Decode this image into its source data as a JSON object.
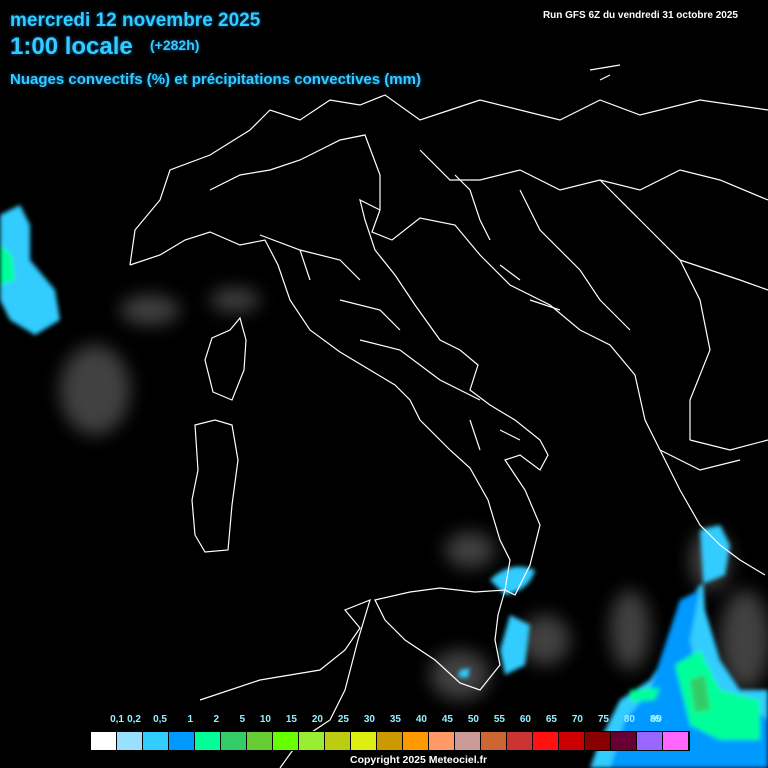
{
  "header": {
    "date": "mercredi 12 novembre 2025",
    "time": "1:00 locale",
    "lead": "(+282h)",
    "parameter": "Nuages convectifs (%) et précipitations convectives (mm)",
    "run": "Run GFS 6Z du vendredi 31 octobre 2025"
  },
  "legend": {
    "labels": [
      "0,1",
      "0,2",
      "0,5",
      "1",
      "2",
      "5",
      "10",
      "15",
      "20",
      "25",
      "30",
      "35",
      "40",
      "45",
      "50",
      "55",
      "60",
      "65",
      "70",
      "75",
      "80",
      "85",
      "90"
    ],
    "colors": [
      "#ffffff",
      "#99e0ff",
      "#33ccff",
      "#0099ff",
      "#00ff99",
      "#33cc66",
      "#66cc33",
      "#66ff00",
      "#99ee33",
      "#bbcc11",
      "#ddee11",
      "#cc9900",
      "#ff9900",
      "#ff9966",
      "#cc9999",
      "#cc6633",
      "#cc3333",
      "#ff1111",
      "#cc0000",
      "#880000",
      "#660033",
      "#9966ff",
      "#ff66ff"
    ]
  },
  "footer": {
    "copyright": "Copyright 2025 Meteociel.fr"
  }
}
